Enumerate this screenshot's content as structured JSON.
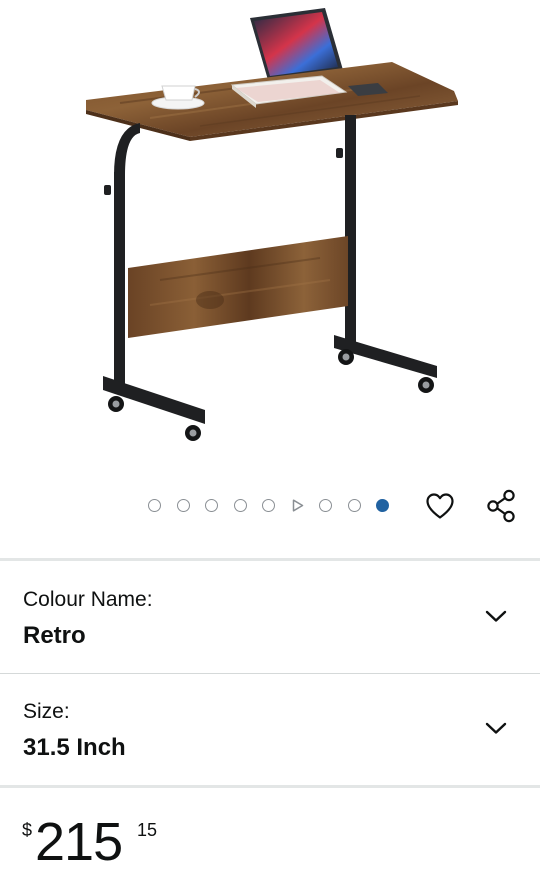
{
  "gallery": {
    "image_count": 9,
    "selected_index": 9,
    "video_index": 6,
    "active_color": "#2162a1",
    "inactive_color": "#8a8f94"
  },
  "actions": {
    "wishlist_icon": "heart-outline-icon",
    "share_icon": "share-icon"
  },
  "variations": [
    {
      "label": "Colour Name:",
      "value": "Retro",
      "icon": "chevron-down-icon"
    },
    {
      "label": "Size:",
      "value": "31.5 Inch",
      "icon": "chevron-down-icon"
    }
  ],
  "price": {
    "symbol": "$",
    "whole": "215",
    "fraction": "15"
  }
}
